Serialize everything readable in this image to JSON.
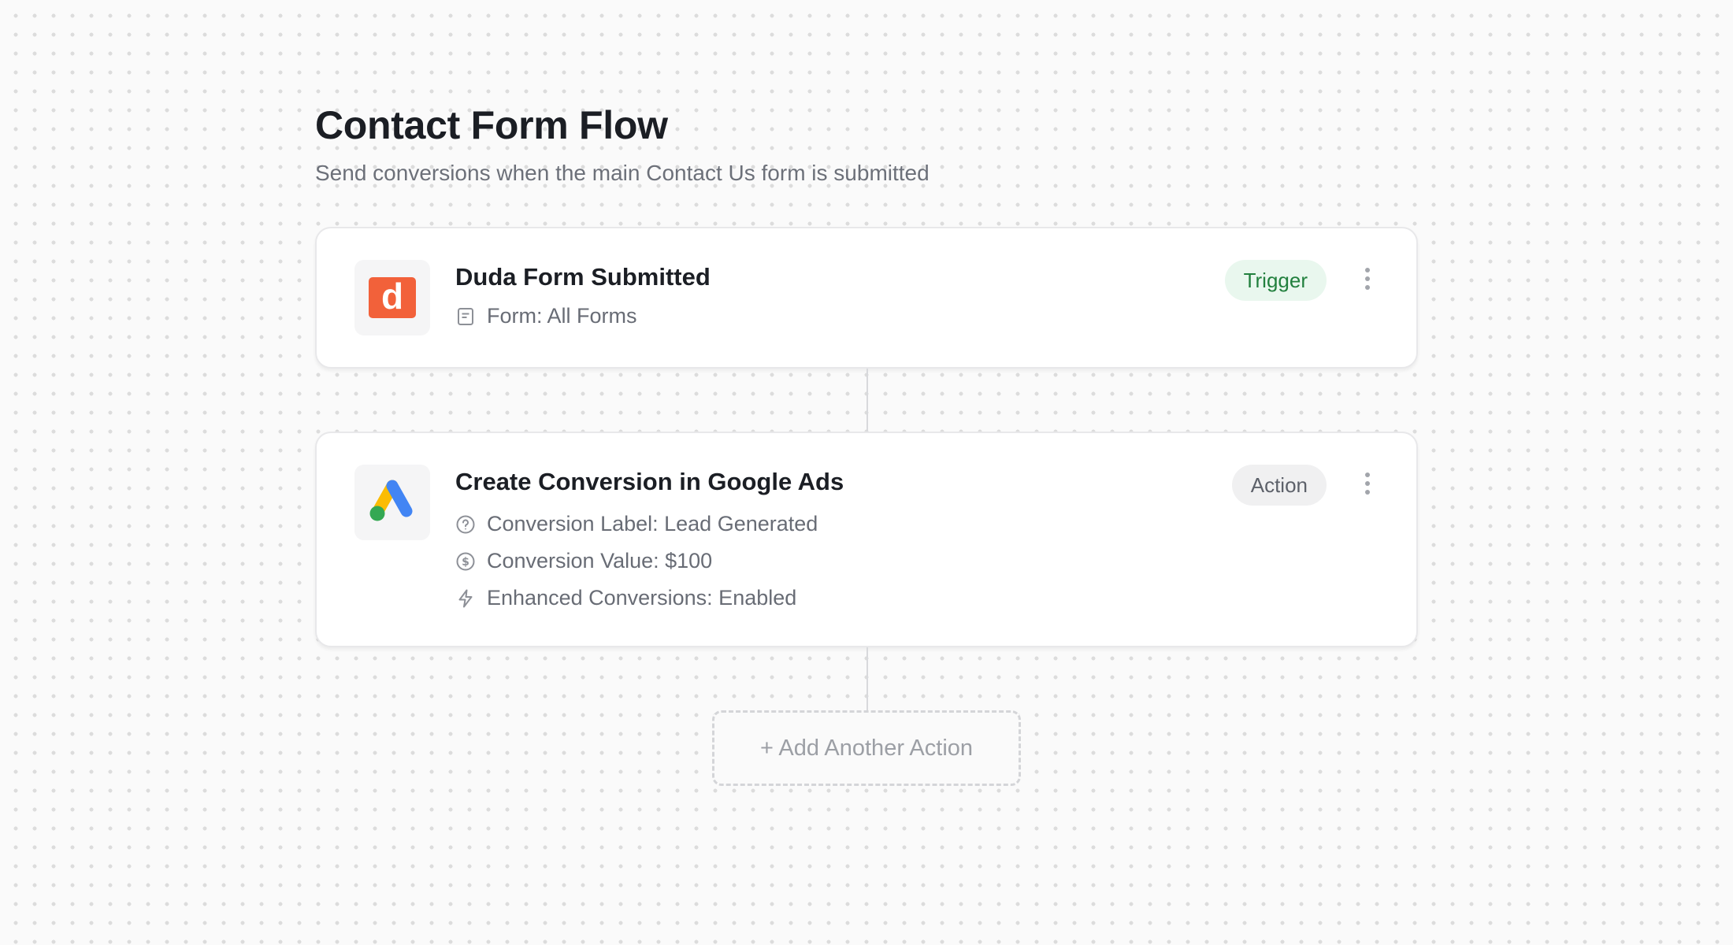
{
  "flow": {
    "title": "Contact Form Flow",
    "subtitle": "Send conversions when the main Contact Us form is submitted"
  },
  "trigger": {
    "app_icon": "duda-logo",
    "logo_letter": "d",
    "title": "Duda Form Submitted",
    "badge": "Trigger",
    "details": [
      {
        "icon": "form-document-icon",
        "text": "Form: All Forms"
      }
    ]
  },
  "action": {
    "app_icon": "google-ads-logo",
    "title": "Create Conversion in Google Ads",
    "badge": "Action",
    "details": [
      {
        "icon": "question-circle-icon",
        "text": "Conversion Label: Lead Generated"
      },
      {
        "icon": "dollar-circle-icon",
        "text": "Conversion Value: $100"
      },
      {
        "icon": "lightning-icon",
        "text": "Enhanced Conversions: Enabled"
      }
    ]
  },
  "add_action_label": "+ Add Another Action",
  "colors": {
    "trigger_badge_bg": "#e9f7ee",
    "trigger_badge_text": "#22803e",
    "duda_brand": "#f2613a",
    "google_blue": "#4285f4",
    "google_yellow": "#fbbc04",
    "google_green": "#34a853"
  }
}
